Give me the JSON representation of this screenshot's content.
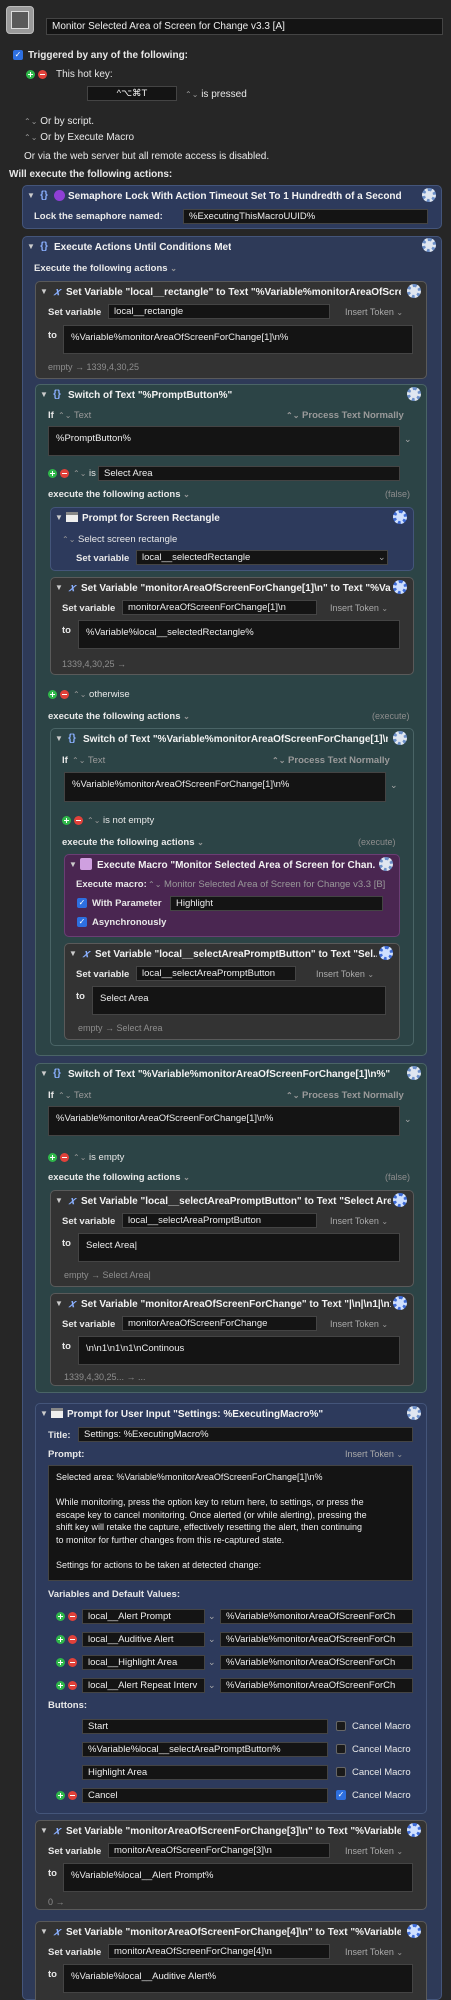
{
  "macro": {
    "title": "Monitor Selected Area of Screen for Change v3.3 [A]"
  },
  "trigger": {
    "header": "Triggered by any of the following:",
    "hotkey_label": "This hot key:",
    "hotkey_value": "^⌥⌘T",
    "hotkey_state": "is pressed",
    "by_script": "Or by script.",
    "by_execute_macro": "Or by Execute Macro",
    "by_web": "Or via the web server but all remote access is disabled.",
    "will_execute": "Will execute the following actions:"
  },
  "semaphore": {
    "title": "Semaphore Lock With Action Timeout Set To 1 Hundredth of a Second",
    "label": "Lock the semaphore named:",
    "value": "%ExecutingThisMacroUUID%"
  },
  "until": {
    "title": "Execute Actions Until Conditions Met",
    "exec_label": "Execute the following actions"
  },
  "setvar1": {
    "title": "Set Variable \"local__rectangle\" to Text \"%Variable%monitorAreaOfScre...",
    "setvar_label": "Set variable",
    "var": "local__rectangle",
    "insert": "Insert Token",
    "to_label": "to",
    "text": "%Variable%monitorAreaOfScreenForChange[1]\\n%",
    "result": "empty → 1339,4,30,25"
  },
  "switch1": {
    "title": "Switch of Text \"%PromptButton%\"",
    "if_label": "If",
    "text_label": "Text",
    "process": "Process Text Normally",
    "value": "%PromptButton%",
    "is_label": "is",
    "is_value": "Select Area",
    "exec_label": "execute the following actions",
    "status": "(false)",
    "otherwise": "otherwise",
    "exec2_label": "execute the following actions",
    "status2": "(execute)"
  },
  "prompt_rect": {
    "title": "Prompt for Screen Rectangle",
    "select_label": "Select screen rectangle",
    "setvar_label": "Set variable",
    "var": "local__selectedRectangle"
  },
  "setvar2": {
    "title": "Set Variable \"monitorAreaOfScreenForChange[1]\\n\" to Text \"%Va...",
    "setvar_label": "Set variable",
    "var": "monitorAreaOfScreenForChange[1]\\n",
    "insert": "Insert Token",
    "to_label": "to",
    "text": "%Variable%local__selectedRectangle%",
    "result": "1339,4,30,25 →"
  },
  "switch2": {
    "title": "Switch of Text \"%Variable%monitorAreaOfScreenForChange[1]\\n...",
    "if_label": "If",
    "text_label": "Text",
    "process": "Process Text Normally",
    "value": "%Variable%monitorAreaOfScreenForChange[1]\\n%",
    "is_label": "is not empty",
    "exec_label": "execute the following actions",
    "status": "(execute)"
  },
  "execmacro": {
    "title": "Execute Macro \"Monitor Selected Area of Screen for Chan...",
    "exec_label": "Execute macro:",
    "macro": "Monitor Selected Area of Screen for Change v3.3 [B]",
    "param_label": "With Parameter",
    "param_value": "Highlight",
    "async_label": "Asynchronously"
  },
  "setvar3": {
    "title": "Set Variable \"local__selectAreaPromptButton\" to Text \"Sel...",
    "setvar_label": "Set variable",
    "var": "local__selectAreaPromptButton",
    "insert": "Insert Token",
    "to_label": "to",
    "text": "Select Area",
    "result": "empty → Select Area"
  },
  "switch3": {
    "title": "Switch of Text \"%Variable%monitorAreaOfScreenForChange[1]\\n%\"",
    "if_label": "If",
    "text_label": "Text",
    "process": "Process Text Normally",
    "value": "%Variable%monitorAreaOfScreenForChange[1]\\n%",
    "is_label": "is empty",
    "exec_label": "execute the following actions",
    "status": "(false)"
  },
  "setvar4": {
    "title": "Set Variable \"local__selectAreaPromptButton\" to Text \"Select Are...",
    "setvar_label": "Set variable",
    "var": "local__selectAreaPromptButton",
    "insert": "Insert Token",
    "to_label": "to",
    "text": "Select Area|",
    "result": "empty → Select Area|"
  },
  "setvar5": {
    "title": "Set Variable \"monitorAreaOfScreenForChange\" to Text \"|\\n|\\n1|\\n1|\\n...",
    "setvar_label": "Set variable",
    "var": "monitorAreaOfScreenForChange",
    "insert": "Insert Token",
    "to_label": "to",
    "text": "\\n\\n1\\n1\\n1\\nContinous",
    "result": "1339,4,30,25... → ..."
  },
  "userinput": {
    "title": "Prompt for User Input \"Settings: %ExecutingMacro%\"",
    "title_label": "Title:",
    "title_value": "Settings: %ExecutingMacro%",
    "prompt_label": "Prompt:",
    "insert": "Insert Token",
    "prompt_lines": [
      "Selected area: %Variable%monitorAreaOfScreenForChange[1]\\n%",
      "",
      "While monitoring, press the option key to return here, to settings, or press the",
      "escape key to cancel monitoring. Once alerted (or while alerting), pressing the",
      "shift key will retake the capture, effectively resetting the alert, then continuing",
      "to monitor for further changes from this re-captured state.",
      "",
      "Settings for actions to be taken at detected change:"
    ],
    "vars_label": "Variables and Default Values:",
    "vars": [
      {
        "name": "local__Alert Prompt",
        "value": "%Variable%monitorAreaOfScreenForCh"
      },
      {
        "name": "local__Auditive Alert",
        "value": "%Variable%monitorAreaOfScreenForCh"
      },
      {
        "name": "local__Highlight Area",
        "value": "%Variable%monitorAreaOfScreenForCh"
      },
      {
        "name": "local__Alert Repeat Interv",
        "value": "%Variable%monitorAreaOfScreenForCh"
      }
    ],
    "buttons_label": "Buttons:",
    "buttons": [
      {
        "name": "Start",
        "cancel": "Cancel Macro",
        "checked": false
      },
      {
        "name": "%Variable%local__selectAreaPromptButton%",
        "cancel": "Cancel Macro",
        "checked": false
      },
      {
        "name": "Highlight Area",
        "cancel": "Cancel Macro",
        "checked": false
      },
      {
        "name": "Cancel",
        "cancel": "Cancel Macro",
        "checked": true
      }
    ]
  },
  "setvar6": {
    "title": "Set Variable \"monitorAreaOfScreenForChange[3]\\n\" to Text \"%Variable...",
    "setvar_label": "Set variable",
    "var": "monitorAreaOfScreenForChange[3]\\n",
    "insert": "Insert Token",
    "to_label": "to",
    "text": "%Variable%local__Alert Prompt%",
    "result": "0 →"
  },
  "setvar7": {
    "title": "Set Variable \"monitorAreaOfScreenForChange[4]\\n\" to Text \"%Variable...",
    "setvar_label": "Set variable",
    "var": "monitorAreaOfScreenForChange[4]\\n",
    "insert": "Insert Token",
    "to_label": "to",
    "text": "%Variable%local__Auditive Alert%"
  },
  "colors": {
    "bg": "#262626",
    "blue_block": "#2d3a5c",
    "teal_block": "#2d4446",
    "purple_block": "#3f2346"
  }
}
